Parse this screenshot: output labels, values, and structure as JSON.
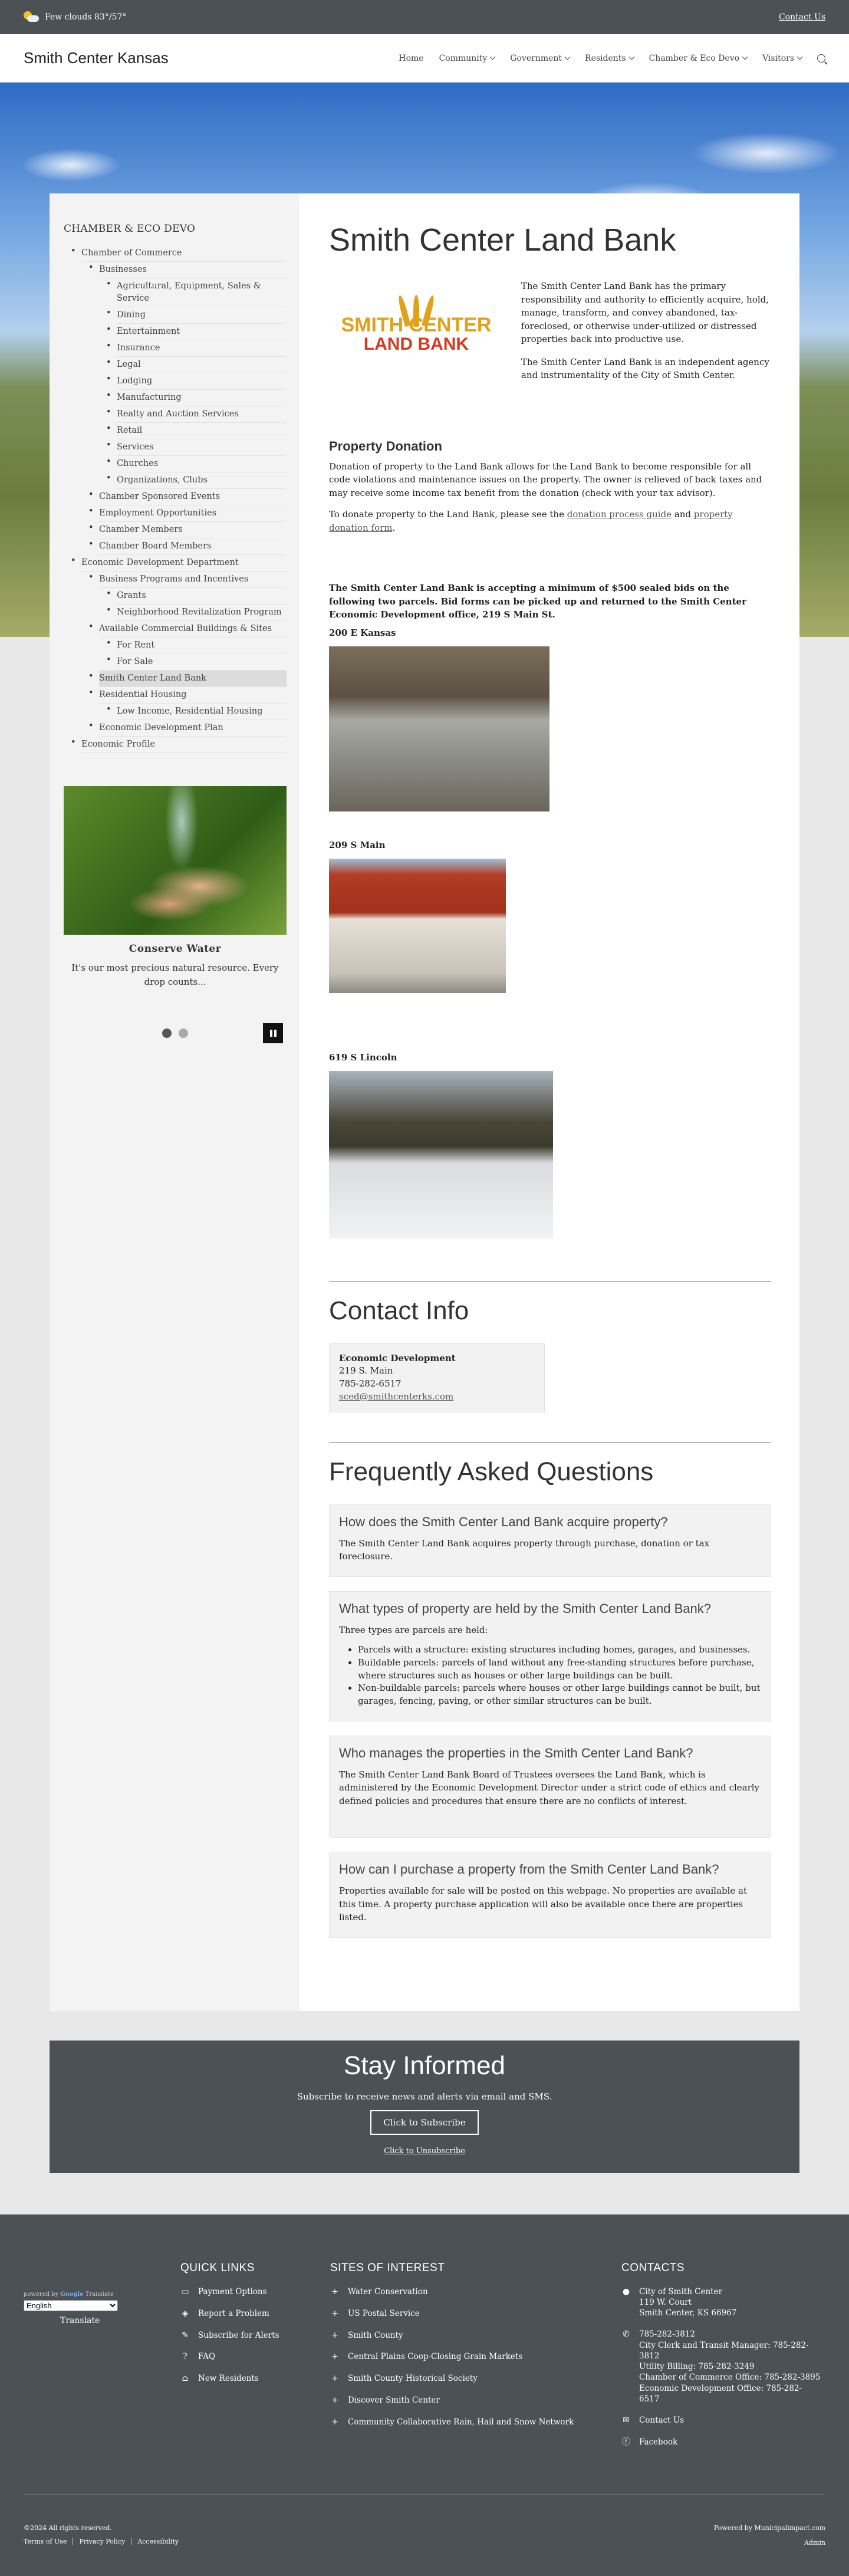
{
  "topbar": {
    "weather": "Few clouds 83°/57°",
    "contact_link": "Contact Us"
  },
  "header": {
    "site_title": "Smith Center Kansas",
    "nav": [
      {
        "label": "Home",
        "dropdown": false
      },
      {
        "label": "Community",
        "dropdown": true
      },
      {
        "label": "Government",
        "dropdown": true
      },
      {
        "label": "Residents",
        "dropdown": true
      },
      {
        "label": "Chamber & Eco Devo",
        "dropdown": true
      },
      {
        "label": "Visitors",
        "dropdown": true
      }
    ]
  },
  "sidebar": {
    "heading": "CHAMBER & ECO DEVO",
    "menu": {
      "chamber": "Chamber of Commerce",
      "businesses": "Businesses",
      "business_items": [
        "Agricultural, Equipment, Sales & Service",
        "Dining",
        "Entertainment",
        "Insurance",
        "Legal",
        "Lodging",
        "Manufacturing",
        "Realty and Auction Services",
        "Retail",
        "Services",
        "Churches",
        "Organizations, Clubs"
      ],
      "chamber_items": [
        "Chamber Sponsored Events",
        "Employment Opportunities",
        "Chamber Members",
        "Chamber Board Members"
      ],
      "eco_dept": "Economic Development Department",
      "programs": "Business Programs and Incentives",
      "program_items": [
        "Grants",
        "Neighborhood Revitalization Program"
      ],
      "available": "Available Commercial Buildings & Sites",
      "available_items": [
        "For Rent",
        "For Sale"
      ],
      "land_bank": "Smith Center Land Bank",
      "residential": "Residential Housing",
      "residential_items": [
        "Low Income, Residential Housing"
      ],
      "plan": "Economic Development Plan",
      "profile": "Economic Profile"
    },
    "slideshow": {
      "title": "Conserve Water",
      "text": "It's our most precious natural resource.  Every drop counts...",
      "slides": 2,
      "active_slide": 1
    }
  },
  "main": {
    "title": "Smith Center Land Bank",
    "logo": {
      "line1": "SMITH CENTER",
      "line2": "LAND BANK"
    },
    "intro": [
      "The Smith Center Land Bank has the primary responsibility and authority to efficiently acquire, hold, manage, transform, and convey abandoned, tax-foreclosed, or otherwise under-utilized or distressed properties back into productive use.",
      "The Smith Center Land Bank is an independent agency and instrumentality of the City of Smith Center."
    ],
    "donation": {
      "heading": "Property Donation",
      "p1": "Donation of property to the Land Bank allows for the Land Bank to become responsible for all code violations and maintenance issues on the property. The owner is relieved of back taxes and may receive some income tax benefit from the donation (check with your tax advisor).",
      "p2_prefix": "To donate property to the Land Bank, please see the ",
      "link1": "donation process guide",
      "p2_mid": " and ",
      "link2": "property donation form",
      "p2_suffix": "."
    },
    "bids_notice": "The Smith Center Land Bank is accepting a minimum of $500 sealed bids on the following two parcels. Bid forms can be picked up and returned to the Smith Center Economic Development office, 219 S Main St.",
    "parcels": [
      {
        "address": "200 E Kansas"
      },
      {
        "address": "209 S Main"
      },
      {
        "address": "619 S Lincoln"
      }
    ],
    "contact": {
      "heading": "Contact Info",
      "name": "Economic Development",
      "address": "219 S. Main",
      "phone": "785-282-6517",
      "email": "sced@smithcenterks.com"
    },
    "faq": {
      "heading": "Frequently Asked Questions",
      "items": [
        {
          "q": "How does the Smith Center Land Bank acquire property?",
          "a": "The Smith Center Land Bank acquires property through purchase, donation or tax foreclosure."
        },
        {
          "q": "What types of property are held by the Smith Center Land Bank?",
          "a": "Three types are parcels are held:",
          "bullets": [
            "Parcels with a structure: existing structures including homes, garages, and businesses.",
            "Buildable parcels: parcels of land without any free-standing structures before purchase, where structures such as houses or other large buildings can be built.",
            "Non-buildable parcels: parcels where houses or other large buildings cannot be built, but garages, fencing, paving, or other similar structures can be built."
          ]
        },
        {
          "q": "Who manages the properties in the Smith Center Land Bank?",
          "a": "The Smith Center Land Bank Board of Trustees oversees the Land Bank, which is administered by the Economic Development Director under a strict code of ethics and clearly defined policies and procedures that ensure there are no conflicts of interest."
        },
        {
          "q": "How can I purchase a property from the Smith Center Land Bank?",
          "a": "Properties available for sale will be posted on this webpage. No properties are available at this time. A property purchase application will also be available once there are properties listed."
        }
      ]
    }
  },
  "stay_informed": {
    "heading": "Stay Informed",
    "text": "Subscribe to receive news and alerts via email and SMS.",
    "subscribe": "Click to Subscribe",
    "unsubscribe": "Click to Unsubscribe"
  },
  "footer": {
    "translate": {
      "powered_by": "powered by",
      "google": "Google",
      "translate_word": "Translate",
      "language": "English",
      "button": "Translate"
    },
    "quick_links": {
      "heading": "QUICK LINKS",
      "items": [
        {
          "icon": "card-icon",
          "label": "Payment Options"
        },
        {
          "icon": "megaphone-icon",
          "label": "Report a Problem"
        },
        {
          "icon": "pencil-icon",
          "label": "Subscribe for Alerts"
        },
        {
          "icon": "question-icon",
          "label": "FAQ"
        },
        {
          "icon": "home-icon",
          "label": "New Residents"
        }
      ]
    },
    "sites": {
      "heading": "SITES OF INTEREST",
      "items": [
        "Water Conservation",
        "US Postal Service",
        "Smith County",
        "Central Plains Coop-Closing Grain Markets",
        "Smith County Historical Society",
        "Discover Smith Center",
        "Community Collaborative Rain, Hail and Snow Network"
      ]
    },
    "contacts": {
      "heading": "CONTACTS",
      "address": [
        "City of Smith Center",
        "119 W. Court",
        "Smith Center, KS 66967"
      ],
      "phones": [
        "785-282-3812",
        "City Clerk and Transit Manager: 785-282-3812",
        "Utility Billing: 785-282-3249",
        "Chamber of Commerce Office: 785-282-3895",
        "Economic Development Office: 785-282-6517"
      ],
      "contact_us": "Contact Us",
      "facebook": "Facebook"
    },
    "copyright": "©2024 All rights reserved.",
    "legal": [
      "Terms of Use",
      "Privacy Policy",
      "Accessibility"
    ],
    "powered_by": "Powered by Municipalimpact.com",
    "admin": "Admin"
  }
}
